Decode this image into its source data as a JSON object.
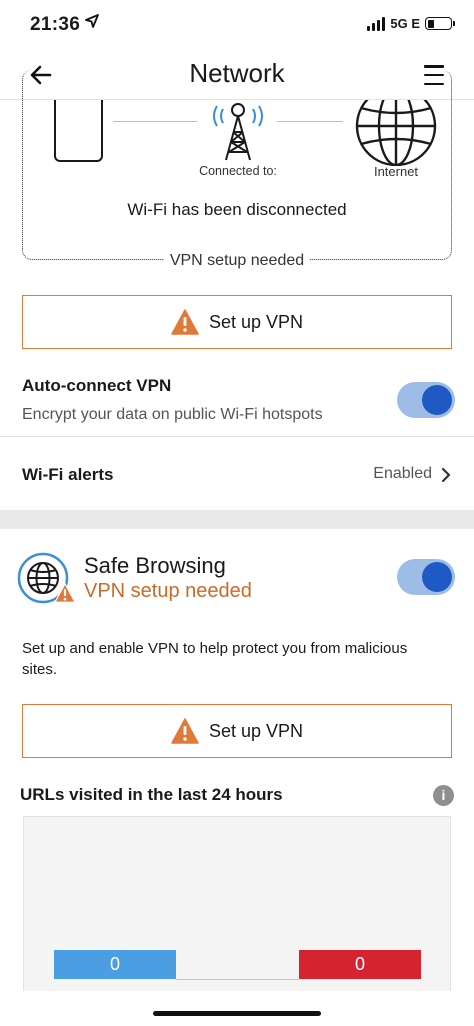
{
  "status_bar": {
    "time": "21:36",
    "network": "5G E",
    "location_icon": "location-arrow-icon"
  },
  "header": {
    "title": "Network",
    "back_icon": "back-arrow-icon",
    "menu_icon": "hamburger-menu-icon"
  },
  "diagram": {
    "connected_label": "Connected to:",
    "internet_label": "Internet",
    "status_message": "Wi-Fi has been disconnected",
    "footer_label": "VPN setup needed"
  },
  "setup_vpn_1": {
    "label": "Set up VPN",
    "icon": "warning-icon"
  },
  "auto_connect": {
    "title": "Auto-connect VPN",
    "subtitle": "Encrypt your data on public Wi-Fi hotspots",
    "enabled": true
  },
  "wifi_alerts": {
    "title": "Wi-Fi alerts",
    "value": "Enabled"
  },
  "safe_browsing": {
    "title": "Safe Browsing",
    "status": "VPN setup needed",
    "description": "Set up and enable VPN to help protect you from malicious sites.",
    "enabled": true
  },
  "setup_vpn_2": {
    "label": "Set up VPN",
    "icon": "warning-icon"
  },
  "urls": {
    "title": "URLs visited in the last 24 hours",
    "info_icon": "i"
  },
  "chart_data": {
    "type": "bar",
    "categories": [
      "",
      ""
    ],
    "values": [
      0,
      0
    ],
    "colors": [
      "#4a9ee1",
      "#d5232f"
    ],
    "labels": [
      "0",
      "0"
    ]
  },
  "colors": {
    "accent_orange": "#e07a39",
    "toggle_track": "#9dbde6",
    "toggle_knob": "#1f5ac4",
    "warning_text": "#c96a2a"
  }
}
